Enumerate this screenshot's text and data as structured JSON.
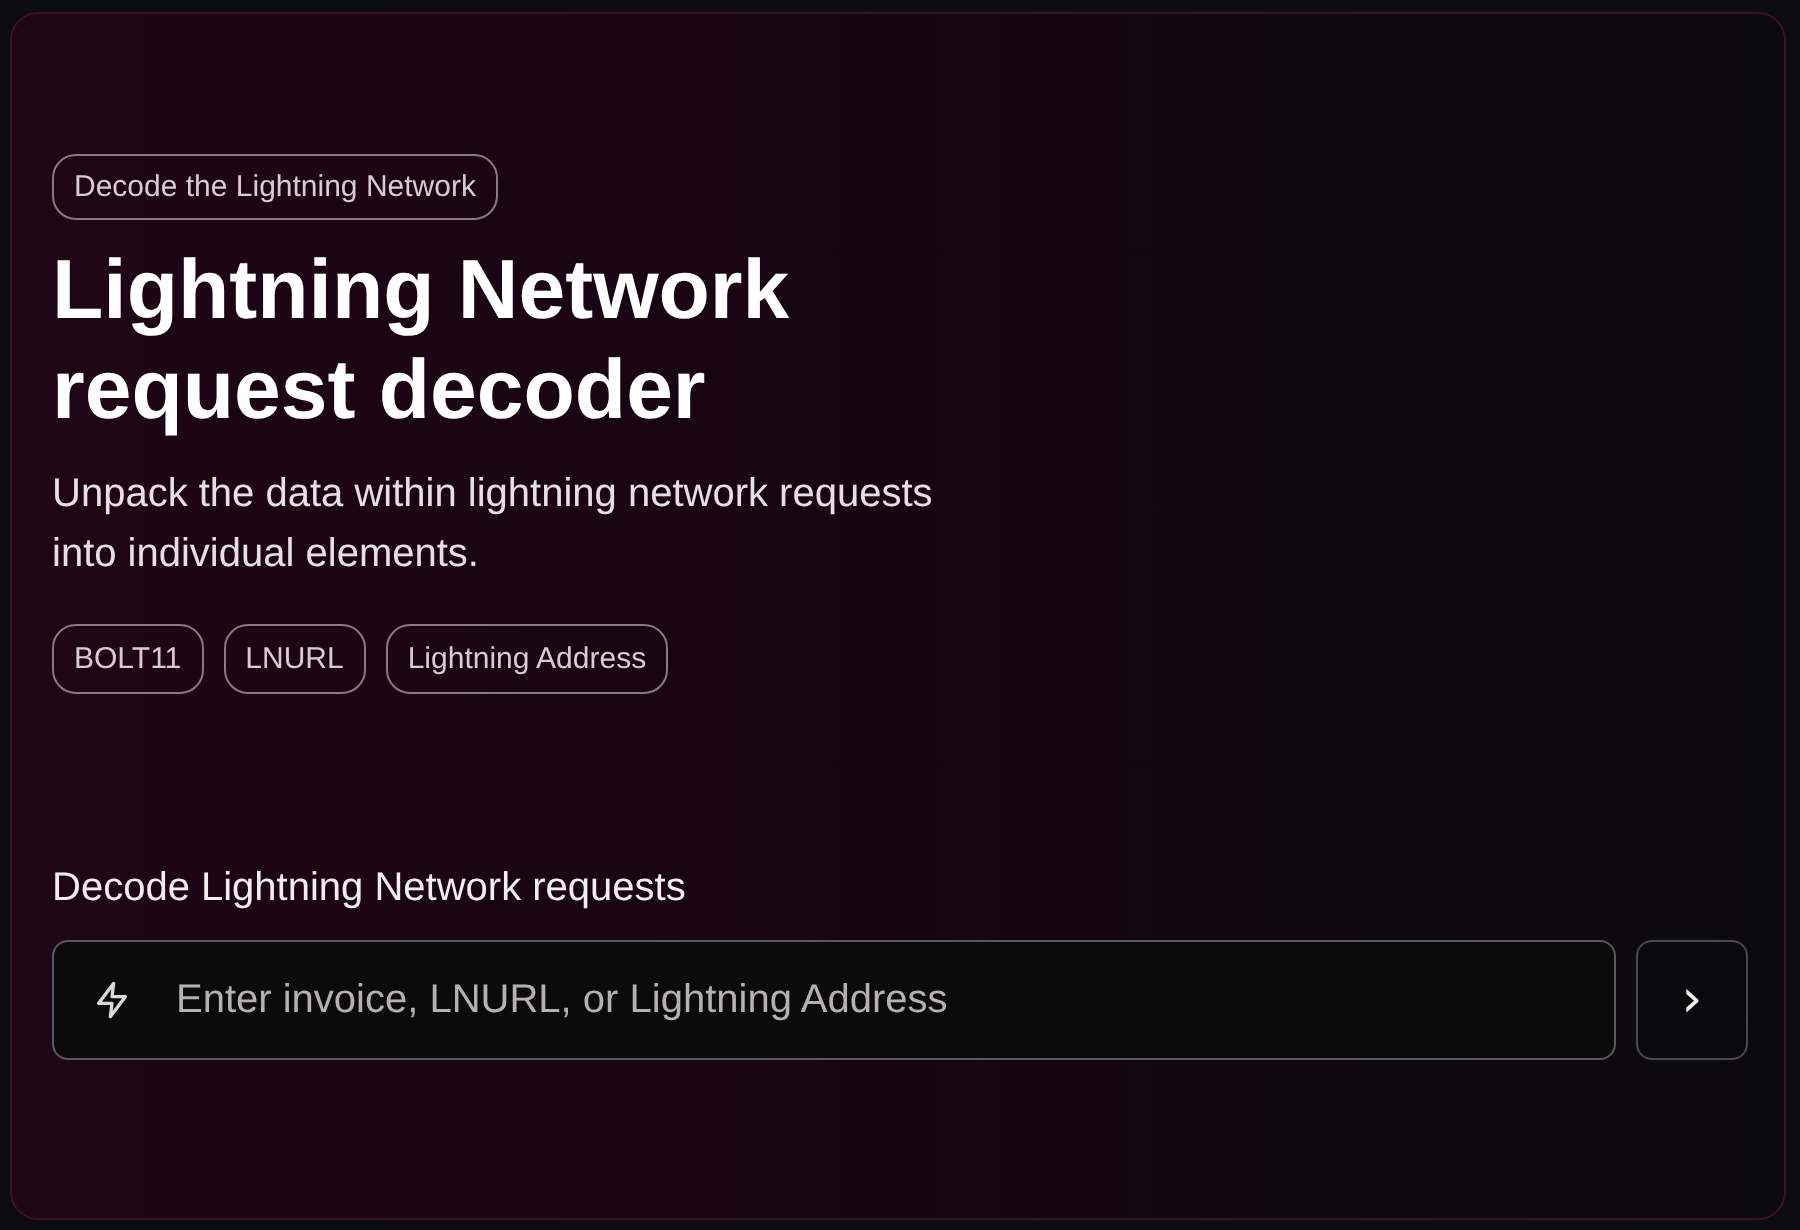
{
  "badge": "Decode the Lightning Network",
  "title": "Lightning Network request decoder",
  "subtitle": "Unpack the data within lightning network requests into individual elements.",
  "tags": [
    "BOLT11",
    "LNURL",
    "Lightning Address"
  ],
  "decoder": {
    "label": "Decode Lightning Network requests",
    "placeholder": "Enter invoice, LNURL, or Lightning Address",
    "submit": "›"
  }
}
